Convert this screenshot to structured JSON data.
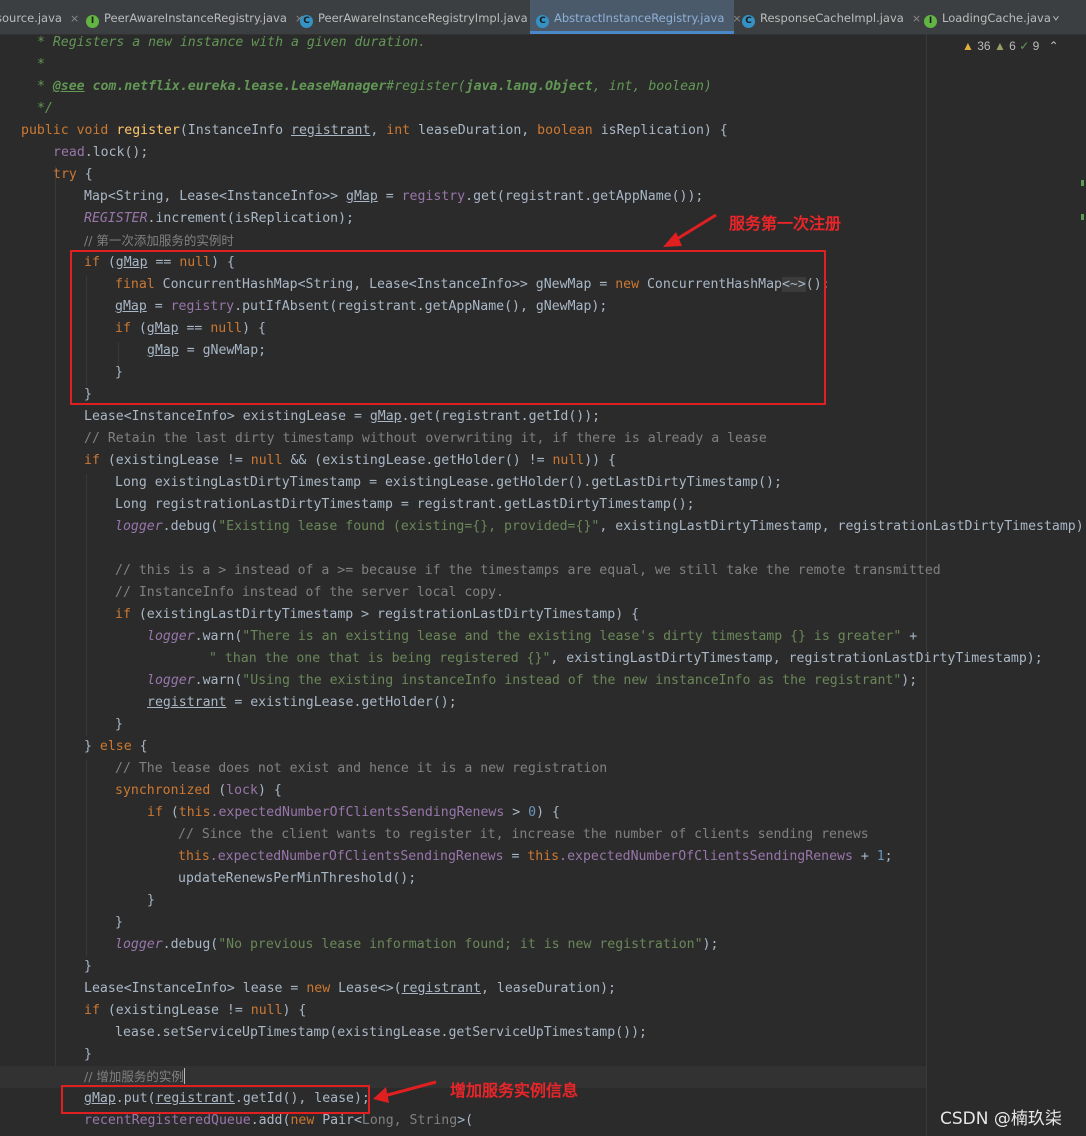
{
  "tabs": [
    {
      "label": "source.java",
      "icon": "",
      "icon_color": ""
    },
    {
      "label": "PeerAwareInstanceRegistry.java",
      "icon": "I",
      "icon_color": "#62b543"
    },
    {
      "label": "PeerAwareInstanceRegistryImpl.java",
      "icon": "C",
      "icon_color": "#3592c4"
    },
    {
      "label": "AbstractInstanceRegistry.java",
      "icon": "C",
      "icon_color": "#3592c4"
    },
    {
      "label": "ResponseCacheImpl.java",
      "icon": "C",
      "icon_color": "#3592c4"
    },
    {
      "label": "LoadingCache.java",
      "icon": "I",
      "icon_color": "#62b543"
    }
  ],
  "active_tab": "AbstractInstanceRegistry.java",
  "tab_close_glyph": "×",
  "tab_more_glyph": "⌄",
  "inspection": {
    "warning_icon": "warning-triangle-icon",
    "warnings": "36",
    "weak_warnings": "6",
    "typos": "9",
    "glyphs": {
      "warning": "▲",
      "weak": "▲",
      "typo": "✓",
      "chevron": "⌃"
    }
  },
  "code": {
    "l_doc1": " * Registers a new instance with a given duration.",
    "l_doc2": " *",
    "l_doc3_pre": " * ",
    "l_doc3_tag": "@see",
    "l_doc3_mid": " com.netflix.eureka.lease.LeaseManager",
    "l_doc3_hash": "#register(",
    "l_doc3_args": "java.lang.Object",
    "l_doc3_end": ", int, boolean)",
    "l_doc4": " */",
    "public": "public",
    "void": "void",
    "register": "register",
    "instanceinfo_param": "(InstanceInfo ",
    "registrant": "registrant",
    "comma": ", ",
    "int": "int",
    "leaseduration_param": " leaseDuration, ",
    "boolean": "boolean",
    "isreplication_param": " isReplication) {",
    "read": "read",
    "lock_call": ".lock();",
    "try": "try",
    "brace_open": " {",
    "map_decl": "Map<String, Lease<InstanceInfo>> ",
    "gmap": "gMap",
    "assign": " = ",
    "registry": "registry",
    "get_appname": ".get(registrant.getAppName());",
    "register_const": "REGISTER",
    "increment": ".increment(isReplication);",
    "cm_first_add": "// 第一次添加服务的实例时",
    "if": "if",
    "if_gmap_null_open": " (",
    "eq_null": " == ",
    "null": "null",
    "paren_brace": ") {",
    "final": "final",
    "chm_decl": " ConcurrentHashMap<String, Lease<InstanceInfo>> gNewMap = ",
    "new": "new",
    "chm_ctor": " ConcurrentHashMap",
    "diamond": "<~>",
    "call_end": "();",
    "putifabsent": ".putIfAbsent(registrant.getAppName(), gNewMap);",
    "gnewmap_end": " = gNewMap;",
    "close_brace": "}",
    "lease_decl": "Lease<InstanceInfo> existingLease = ",
    "get_id": ".get(registrant.getId());",
    "cm_retain": "// Retain the last dirty timestamp without overwriting it, if there is already a lease",
    "if_existing_a": " (existingLease != ",
    "if_existing_b": " && (existingLease.getHolder() != ",
    "if_existing_c": ")) {",
    "long_existing": "Long existingLastDirtyTimestamp = existingLease.getHolder().getLastDirtyTimestamp();",
    "long_registration": "Long registrationLastDirtyTimestamp = registrant.getLastDirtyTimestamp();",
    "logger": "logger",
    "debug_open": ".debug(",
    "str_existing_found": "\"Existing lease found (existing={}, provided={}\"",
    "debug_args": ", existingLastDirtyTimestamp, registrationLastDirtyTimestamp);",
    "cm_this_is": "// this is a > instead of a >= because if the timestamps are equal, we still take the remote transmitted",
    "cm_instanceinfo": "// InstanceInfo instead of the server local copy.",
    "if_compare": " (existingLastDirtyTimestamp > registrationLastDirtyTimestamp) {",
    "warn_open": ".warn(",
    "str_there_is": "\"There is an existing lease and the existing lease's dirty timestamp {} is greater\"",
    "plus": " +",
    "str_than": "\" than the one that is being registered {}\"",
    "warn_args": ", existingLastDirtyTimestamp, registrationLastDirtyTimestamp);",
    "str_using": "\"Using the existing instanceInfo instead of the new instanceInfo as the registrant\"",
    "paren_semicolon": ");",
    "get_holder": " = existingLease.getHolder();",
    "close_else": "} ",
    "else": "else",
    "cm_not_exist": "// The lease does not exist and hence it is a new registration",
    "synchronized": "synchronized",
    "lock_arg_open": " (",
    "lock_field": "lock",
    "this": "this",
    "expected_field": ".expectedNumberOfClientsSendingRenews",
    "gt": " > ",
    "zero": "0",
    "cm_since": "// Since the client wants to register it, increase the number of clients sending renews",
    "plus_one": " + ",
    "one": "1",
    "semicolon": ";",
    "update_renews": "updateRenewsPerMinThreshold();",
    "str_no_previous": "\"No previous lease information found; it is new registration\"",
    "lease_new_decl": "Lease<InstanceInfo> lease = ",
    "lease_ctor": " Lease<>(",
    "lease_ctor_end": ", leaseDuration);",
    "if_existing_ne": " (existingLease != ",
    "set_service_up": "lease.setServiceUpTimestamp(existingLease.getServiceUpTimestamp());",
    "cm_add_instance": "// 增加服务的实例",
    "put_open": ".put(",
    "put_mid": ".getId(), lease);",
    "recent_queue": "recentRegisteredQueue",
    "add_new": ".add(",
    "pair_type": " Pair<",
    "pair_types": "Long, String",
    "pair_end": ">("
  },
  "annotations": {
    "first_register": "服务第一次注册",
    "add_instance_info": "增加服务实例信息"
  },
  "watermark": "CSDN @楠玖柒"
}
